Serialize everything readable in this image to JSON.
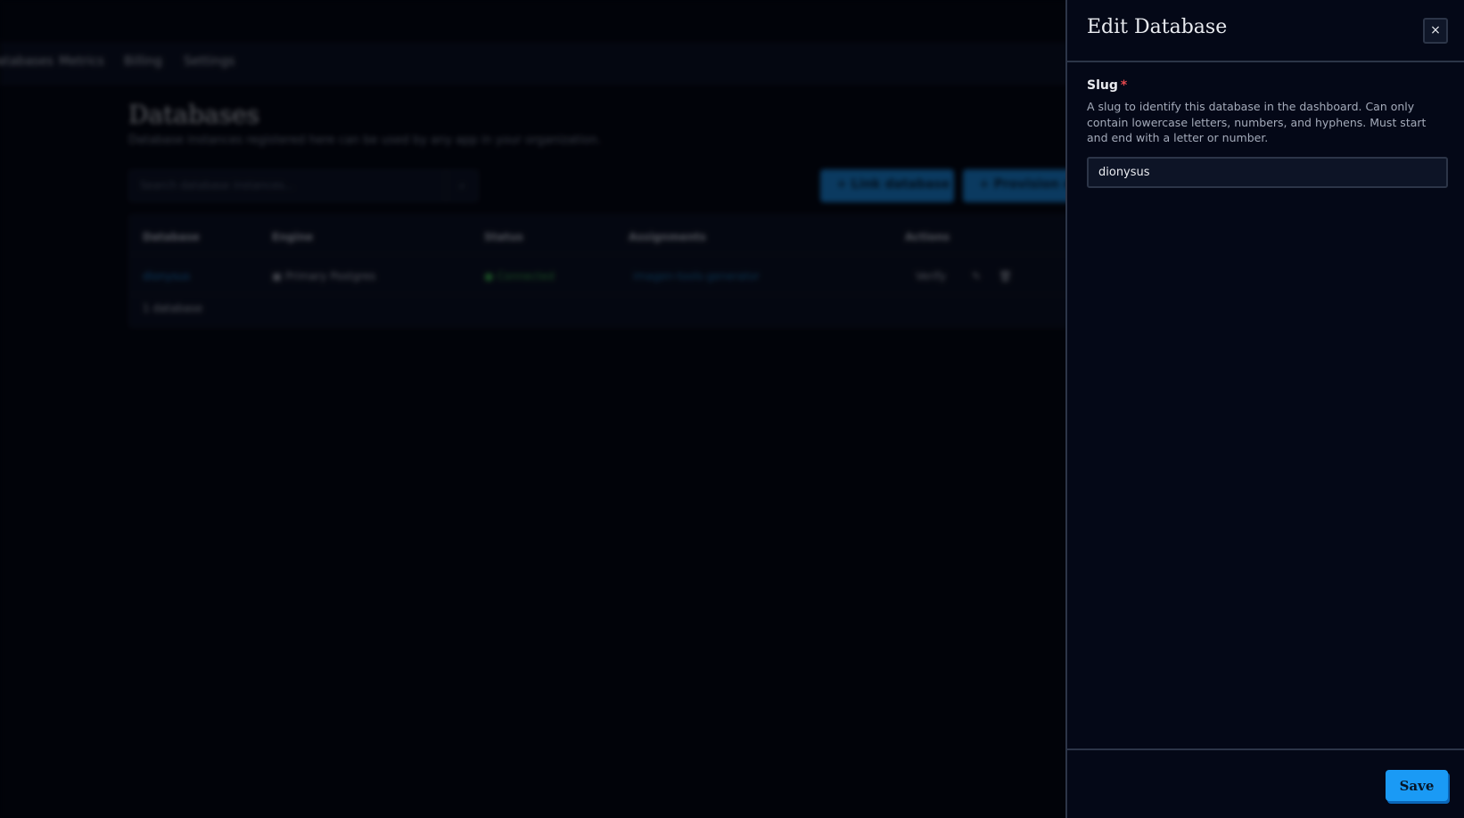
{
  "background": {
    "nav": [
      "Databases",
      "Metrics",
      "Billing",
      "Settings"
    ],
    "title": "Databases",
    "subtitle": "Database instances registered here can be used by any app in your organization.",
    "search_placeholder": "Search database instances...",
    "buttons": {
      "link": "+ Link database",
      "provision": "+ Provision database"
    },
    "table": {
      "headers": [
        "Database",
        "Engine",
        "Status",
        "Assignments",
        "Actions"
      ],
      "row": {
        "database": "dionysus",
        "engine": "Primary Postgres",
        "status": "Connected",
        "assignment": "imagen-tools-generator",
        "verify": "Verify"
      },
      "footer": "1 database"
    }
  },
  "panel": {
    "title": "Edit Database",
    "close_label": "×",
    "field": {
      "label": "Slug",
      "required_mark": "*",
      "description": "A slug to identify this database in the dashboard. Can only contain lowercase letters, numbers, and hyphens. Must start and end with a letter or number.",
      "value": "dionysus"
    },
    "save_label": "Save"
  }
}
